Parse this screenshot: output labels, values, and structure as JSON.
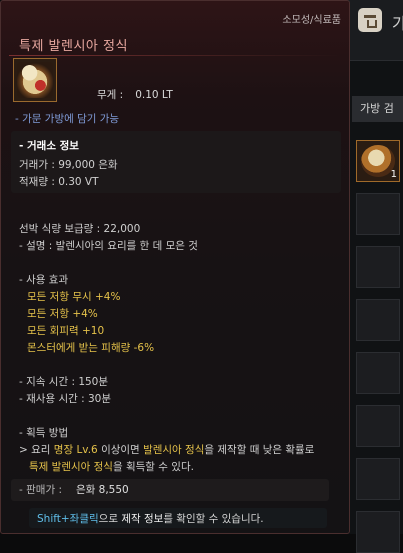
{
  "inventory": {
    "header_char": "가",
    "search_label": "가방 검",
    "item_count": "1"
  },
  "tooltip": {
    "category": "소모성/식료품",
    "title": "특제 발렌시아 정식",
    "weight_label": "무게 :",
    "weight_value": "0.10 LT",
    "carry_note": "- 가문 가방에 담기 가능",
    "trade": {
      "title": "- 거래소 정보",
      "price": "거래가 : 99,000 은화",
      "stock": "적재량 : 0.30 VT"
    },
    "ship_supply": "선박 식량 보급량 : 22,000",
    "description": "- 설명 : 발렌시아의 요리를 한 데 모은 것",
    "effects_title": "- 사용 효과",
    "effects": [
      "모든 저항 무시 +4%",
      "모든 저항 +4%",
      "모든 회피력 +10",
      "몬스터에게 받는 피해량 -6%"
    ],
    "duration": "- 지속 시간 : 150분",
    "cooldown": "- 재사용 시간 : 30분",
    "acquire": {
      "title": "- 획득 방법",
      "line1_a": "> 요리 ",
      "line1_b": "명장 Lv.6",
      "line1_c": " 이상이면 ",
      "line1_d": "발렌시아 정식",
      "line1_e": "을 제작할 때 낮은 확률로",
      "line2_a": "특제 발렌시아 정식",
      "line2_b": "을 획득할 수 있다."
    },
    "sell_label": "- 판매가 :",
    "sell_value": "은화 8,550",
    "hint_key": "Shift+좌클릭",
    "hint_mid": "으로 ",
    "hint_word": "제작 정보",
    "hint_end": "를 확인할 수 있습니다."
  }
}
